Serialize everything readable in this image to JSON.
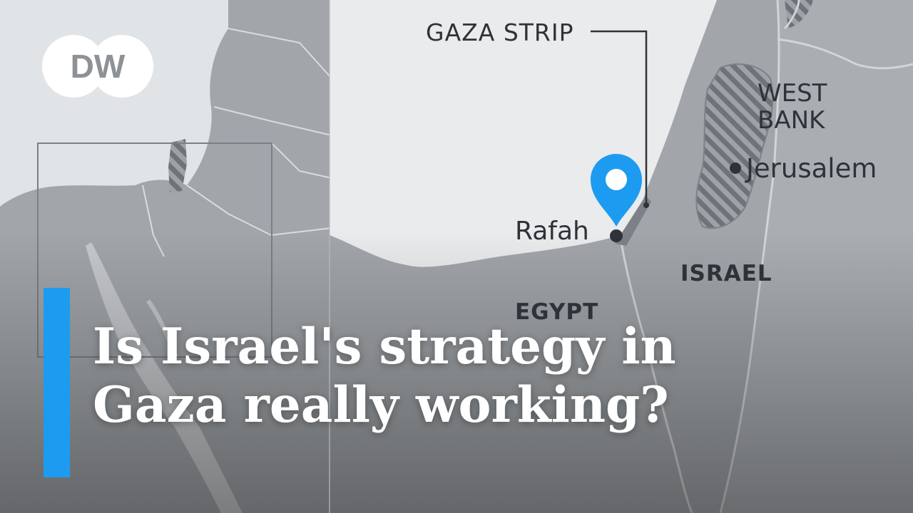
{
  "brand": {
    "logo_text": "DW"
  },
  "map": {
    "labels": {
      "gaza_strip": "GAZA STRIP",
      "west_bank_line1": "WEST",
      "west_bank_line2": "BANK",
      "jerusalem": "Jerusalem",
      "rafah": "Rafah",
      "israel": "ISRAEL",
      "egypt": "EGYPT"
    },
    "marker_icon": "location-pin-icon",
    "colors": {
      "sea": "#e9ebed",
      "land": "#a2a6aa",
      "hatched_territory": "#7d8187",
      "borders": "#d4d7da",
      "marker": "#1d9bf0",
      "accent": "#1d9bf0"
    }
  },
  "headline": {
    "line1": "Is Israel's strategy in",
    "line2": "Gaza really working?"
  }
}
